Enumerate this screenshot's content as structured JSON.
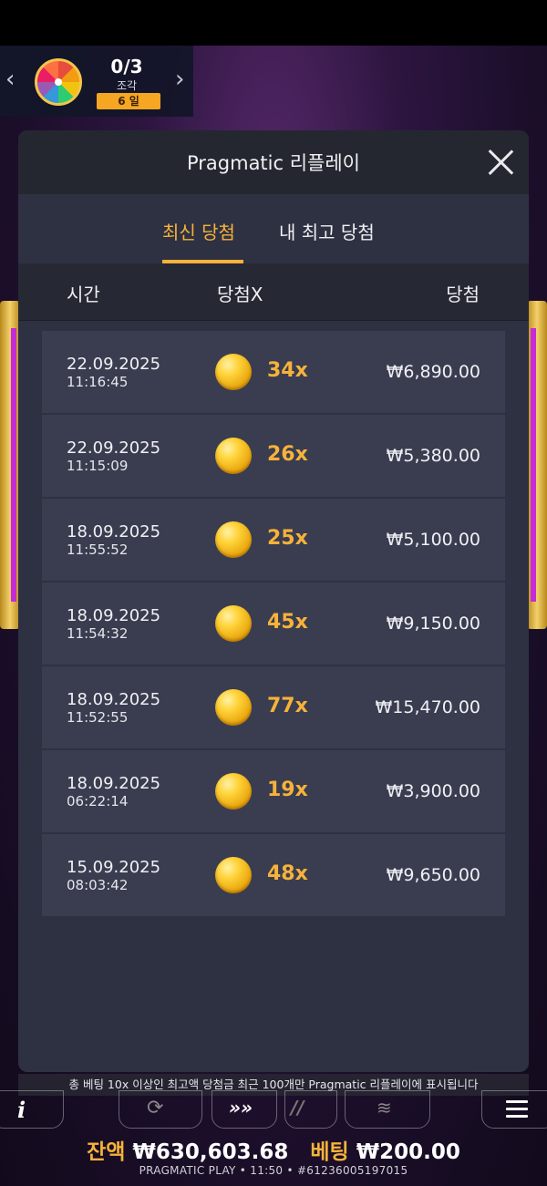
{
  "prize": {
    "count": "0/3",
    "label": "조각",
    "days": "6 일",
    "prev_icon": "chevron-left-icon",
    "next_icon": "chevron-right-icon"
  },
  "modal": {
    "title": "Pragmatic 리플레이",
    "tabs": [
      {
        "label": "최신 당첨",
        "active": true
      },
      {
        "label": "내 최고 당첨",
        "active": false
      }
    ],
    "columns": {
      "time": "시간",
      "multiplier": "당첨X",
      "win": "당첨"
    },
    "rows": [
      {
        "date": "22.09.2025",
        "time": "11:16:45",
        "multiplier": "34x",
        "amount": "₩6,890.00"
      },
      {
        "date": "22.09.2025",
        "time": "11:15:09",
        "multiplier": "26x",
        "amount": "₩5,380.00"
      },
      {
        "date": "18.09.2025",
        "time": "11:55:52",
        "multiplier": "25x",
        "amount": "₩5,100.00"
      },
      {
        "date": "18.09.2025",
        "time": "11:54:32",
        "multiplier": "45x",
        "amount": "₩9,150.00"
      },
      {
        "date": "18.09.2025",
        "time": "11:52:55",
        "multiplier": "77x",
        "amount": "₩15,470.00"
      },
      {
        "date": "18.09.2025",
        "time": "06:22:14",
        "multiplier": "19x",
        "amount": "₩3,900.00"
      },
      {
        "date": "15.09.2025",
        "time": "08:03:42",
        "multiplier": "48x",
        "amount": "₩9,650.00"
      }
    ],
    "footer_note": "총 베팅 10x 이상인 최고액 당첨금 최근 100개만 Pragmatic 리플레이에 표시됩니다"
  },
  "controls": {
    "info_glyph": "i",
    "turbo_glyph": "»»",
    "quick_glyph": "//",
    "autoplay_glyph": "⟳",
    "coins_glyph": "≋"
  },
  "balance": {
    "balance_label": "잔액",
    "balance_value": "₩630,603.68",
    "bet_label": "베팅",
    "bet_value": "₩200.00"
  },
  "status_line": "PRAGMATIC PLAY • 11:50 • #61236005197015",
  "colors": {
    "accent": "#f6b23a",
    "modal_bg": "#2e3142",
    "row_bg": "#3a3d50"
  }
}
